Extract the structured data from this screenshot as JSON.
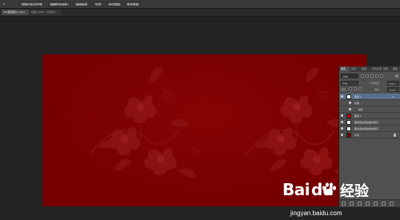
{
  "toolbar": {
    "items": [
      {
        "label": "调整边缘/对齐调整",
        "icon": "dropdown"
      },
      {
        "label": "编辑所有画板",
        "icon": "dropdown"
      },
      {
        "label": "编辑画板"
      },
      {
        "label": "选项"
      },
      {
        "label": "适合屏幕"
      },
      {
        "label": "填充屏幕"
      }
    ]
  },
  "document_tabs": [
    {
      "label": "3D-图层副本 1.psd",
      "active": true
    },
    {
      "label": "绘图-RGB/8 - 未标题-1"
    }
  ],
  "layers_panel": {
    "tabs": [
      "图层",
      "通道",
      "路径",
      "历史记录",
      "调整",
      "属性"
    ],
    "filter_label": "种类",
    "blend_mode": "正常",
    "opacity_label": "不透明度:",
    "opacity_value": "100%",
    "lock_label": "锁定:",
    "fill_label": "填充:",
    "fill_value": "100%",
    "layers": [
      {
        "name": "图层 1",
        "selected": true,
        "thumb": "white",
        "effect": "fx"
      },
      {
        "name": "效果",
        "sub": true
      },
      {
        "name": "投影",
        "sub": true,
        "indent": true
      },
      {
        "name": "图层 2",
        "thumb": "red"
      },
      {
        "name": "图案填充底纹素材拷贝",
        "thumb": "white"
      },
      {
        "name": "图案填充底纹素材拷贝",
        "thumb": "white"
      },
      {
        "name": "背景",
        "thumb": "darkred",
        "locked": true
      }
    ]
  },
  "watermark": {
    "brand": "Bai",
    "brand_suffix": "du",
    "product": "经验",
    "url": "jingyan.baidu.com"
  },
  "colors": {
    "canvas": "#7a0000",
    "panel_selected": "#5a6f8c",
    "app_bg": "#232323"
  }
}
